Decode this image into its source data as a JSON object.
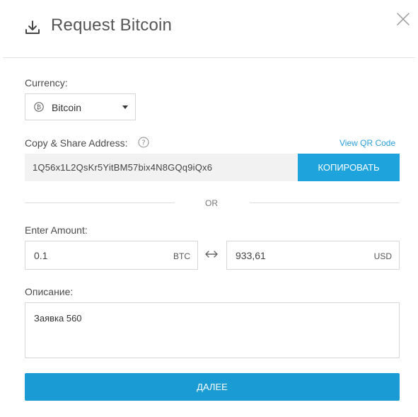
{
  "header": {
    "title": "Request Bitcoin",
    "icon": "download-icon",
    "close_icon": "close-icon"
  },
  "currency": {
    "label": "Currency:",
    "selected": "Bitcoin",
    "icon": "bitcoin-icon"
  },
  "address": {
    "label": "Copy & Share Address:",
    "help_icon": "question-icon",
    "qr_link": "View QR Code",
    "value": "1Q56x1L2QsKr5YitBM57bix4N8GQq9iQx6",
    "copy_button": "КОПИРОВАТЬ"
  },
  "divider": {
    "text": "OR"
  },
  "amount": {
    "label": "Enter Amount:",
    "crypto_value": "0.1",
    "crypto_unit": "BTC",
    "fiat_value": "933,61",
    "fiat_unit": "USD",
    "swap_icon": "swap-arrows-icon"
  },
  "description": {
    "label": "Описание:",
    "value": "Заявка 560"
  },
  "next_button": "ДАЛЕЕ",
  "colors": {
    "accent": "#1fa3dd",
    "link": "#2a9fd6"
  }
}
